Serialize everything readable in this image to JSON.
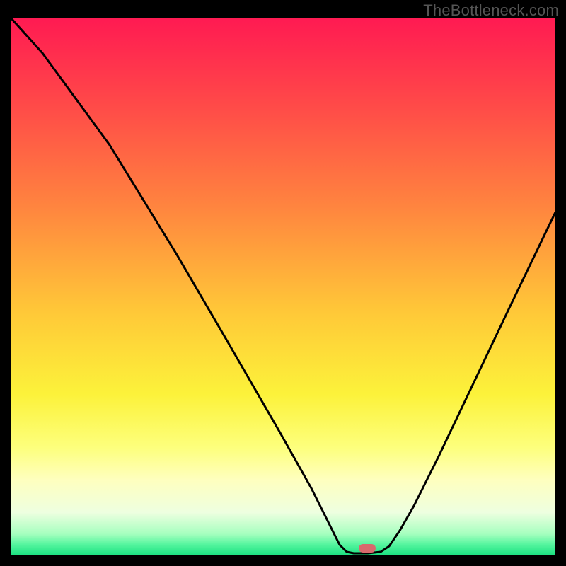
{
  "watermark": "TheBottleneck.com",
  "chart_data": {
    "type": "line",
    "title": "",
    "xlabel": "",
    "ylabel": "",
    "xlim": [
      15,
      785
    ],
    "ylim": [
      25,
      785
    ],
    "gradient_stops": [
      {
        "offset": "0%",
        "color": "#FF1A52"
      },
      {
        "offset": "15%",
        "color": "#FF4649"
      },
      {
        "offset": "35%",
        "color": "#FF843F"
      },
      {
        "offset": "55%",
        "color": "#FFC938"
      },
      {
        "offset": "70%",
        "color": "#FCF23A"
      },
      {
        "offset": "80%",
        "color": "#FDFF7D"
      },
      {
        "offset": "86%",
        "color": "#FEFFBF"
      },
      {
        "offset": "92%",
        "color": "#EEFFE0"
      },
      {
        "offset": "96%",
        "color": "#A6FFBF"
      },
      {
        "offset": "98%",
        "color": "#54F59E"
      },
      {
        "offset": "100%",
        "color": "#19E080"
      }
    ],
    "series": [
      {
        "name": "bottleneck-curve",
        "color": "#000000",
        "width": 3,
        "points": [
          [
            15,
            25
          ],
          [
            60,
            75
          ],
          [
            155,
            205
          ],
          [
            250,
            360
          ],
          [
            320,
            480
          ],
          [
            395,
            610
          ],
          [
            440,
            690
          ],
          [
            465,
            740
          ],
          [
            480,
            770
          ],
          [
            490,
            780
          ],
          [
            500,
            782
          ],
          [
            520,
            782
          ],
          [
            538,
            780
          ],
          [
            550,
            772
          ],
          [
            565,
            750
          ],
          [
            585,
            715
          ],
          [
            620,
            645
          ],
          [
            670,
            540
          ],
          [
            720,
            435
          ],
          [
            785,
            300
          ]
        ]
      }
    ],
    "marker": {
      "name": "valley-marker",
      "color": "#D86A6D",
      "x": 519,
      "y": 775,
      "w": 24,
      "h": 12
    }
  }
}
